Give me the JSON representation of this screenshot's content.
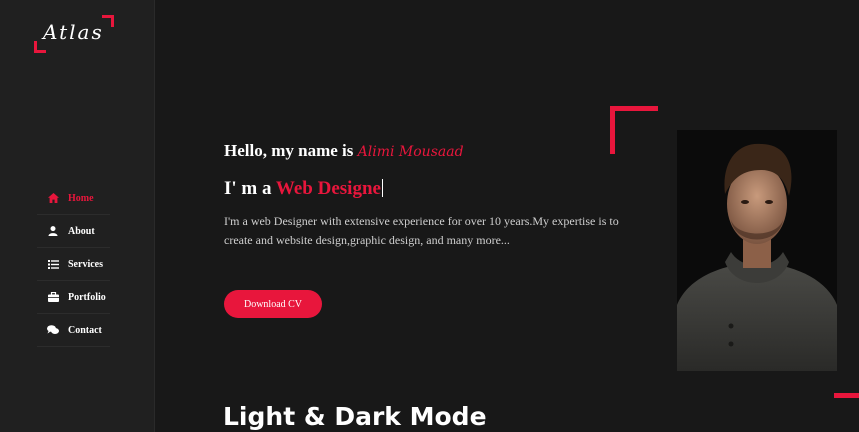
{
  "brand": {
    "logo_text": "Atlas",
    "accent": "#e8163c"
  },
  "nav": {
    "items": [
      {
        "label": "Home",
        "icon": "home-icon",
        "active": true
      },
      {
        "label": "About",
        "icon": "user-icon",
        "active": false
      },
      {
        "label": "Services",
        "icon": "list-icon",
        "active": false
      },
      {
        "label": "Portfolio",
        "icon": "briefcase-icon",
        "active": false
      },
      {
        "label": "Contact",
        "icon": "chat-icon",
        "active": false
      }
    ]
  },
  "hero": {
    "greeting": "Hello, my name is ",
    "name": "Alimi Mousaad",
    "role_prefix": "I' m a ",
    "role_word": "Web Designe",
    "description": "I'm a web Designer with extensive experience for over 10 years.My expertise is to create and website design,graphic design, and many more...",
    "cv_button": "Download CV"
  },
  "section": {
    "title": "Light & Dark Mode"
  }
}
